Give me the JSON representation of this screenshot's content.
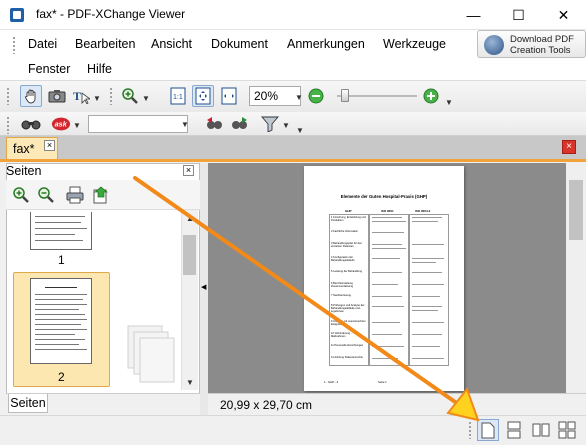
{
  "window": {
    "title": "fax* - PDF-XChange Viewer",
    "minimize": "—",
    "maximize": "☐",
    "close": "✕"
  },
  "menu": {
    "row1": [
      "Datei",
      "Bearbeiten",
      "Ansicht",
      "Dokument",
      "Anmerkungen",
      "Werkzeuge"
    ],
    "row2": [
      "Fenster",
      "Hilfe"
    ]
  },
  "download_button": {
    "line1": "Download PDF",
    "line2": "Creation Tools"
  },
  "toolbar": {
    "zoom_value": "20%",
    "search_value": ""
  },
  "document_tab": {
    "label": "fax*"
  },
  "pages_pane": {
    "title": "Seiten",
    "thumbnails": [
      {
        "label": "1"
      },
      {
        "label": "2"
      }
    ],
    "tab_label": "Seiten"
  },
  "document": {
    "page_title": "Elemente der Guten Hospital-Praxis (GHP)",
    "col_headers": [
      "GHP",
      "ISO 9001",
      "ISO 9004-2"
    ],
    "row_labels": [
      "1  Forschung, Entwicklung und Produktion",
      "2  Fachliche Information",
      "3  Behandlungsplan für den einzelnen Patienten",
      "4  Konfiguration der Behandlungsablaufs",
      "5  Leistung der Behandlung",
      "6  Berichterstattung Zusammenfassung",
      "7  Nachbetreuung",
      "8  Prüfungen und Analyse der Behandlungsabläufe und -ergebnisse",
      "9  Umgang mit unerwünschten Ereignissen",
      "10 Verhinderung ... Maßnahmen",
      "11 Personelle Einrichtungen",
      "12 Achtung Patientenrechte"
    ],
    "footer_left": "1 - GHP - 4",
    "footer_right": "Seite 1"
  },
  "status": {
    "page_size": "20,99 x 29,70 cm"
  },
  "colors": {
    "accent_orange": "#f28a1a",
    "tab_highlight": "#fde8b8",
    "view_background": "#8b8b8b"
  }
}
